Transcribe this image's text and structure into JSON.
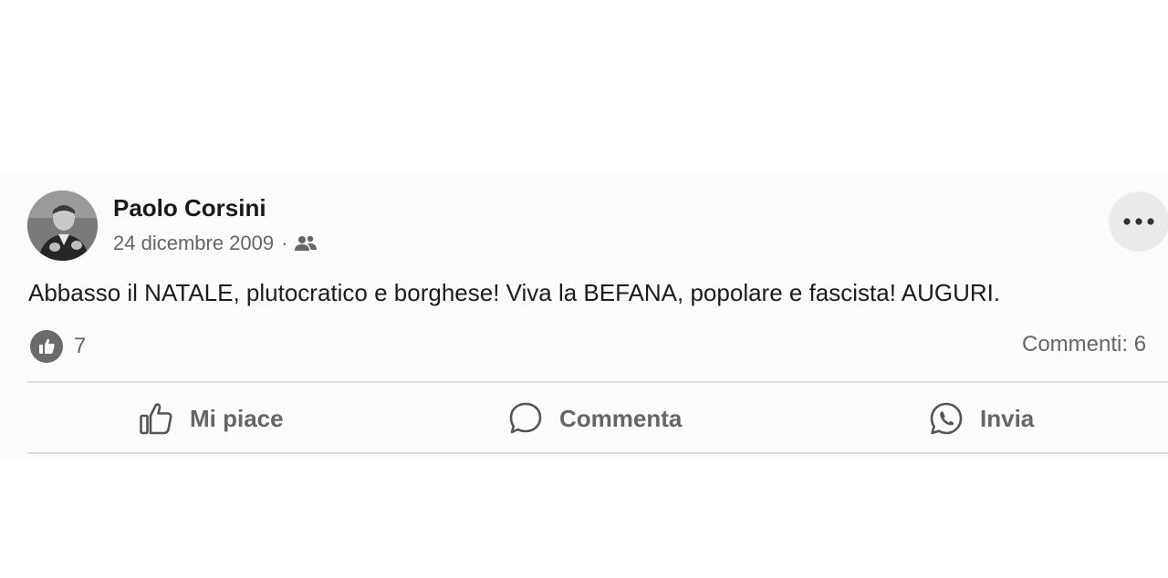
{
  "post": {
    "author": "Paolo Corsini",
    "date": "24 dicembre 2009",
    "separator": "·",
    "audience_icon": "friends-icon",
    "text": "Abbasso il NATALE, plutocratico e borghese! Viva la BEFANA, popolare e fascista! AUGURI.",
    "reactions": {
      "icon": "thumbs-up-icon",
      "count": "7"
    },
    "comments_label": "Commenti: 6"
  },
  "actions": {
    "like_label": "Mi piace",
    "comment_label": "Commenta",
    "share_label": "Invia"
  },
  "colors": {
    "text": "#1c1c1c",
    "secondary_text": "#666666",
    "divider": "#dddddd",
    "background": "#fbfbfb"
  }
}
